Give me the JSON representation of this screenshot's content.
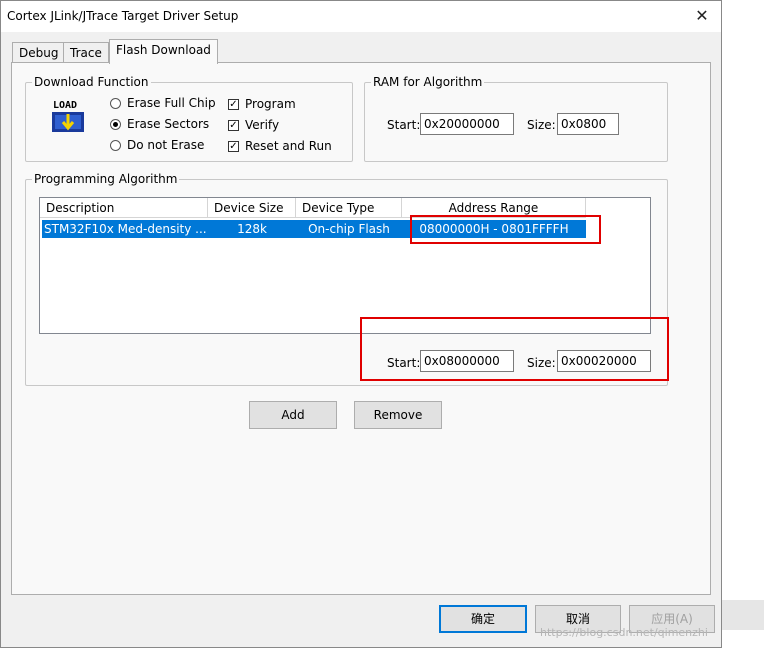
{
  "window": {
    "title": "Cortex JLink/JTrace Target Driver Setup",
    "close_glyph": "✕"
  },
  "tabs": [
    {
      "label": "Debug"
    },
    {
      "label": "Trace"
    },
    {
      "label": "Flash Download",
      "active": true
    }
  ],
  "download_function": {
    "legend": "Download Function",
    "icon_label": "LOAD",
    "radios": [
      {
        "label": "Erase Full Chip",
        "checked": false
      },
      {
        "label": "Erase Sectors",
        "checked": true
      },
      {
        "label": "Do not Erase",
        "checked": false
      }
    ],
    "checkboxes": [
      {
        "label": "Program",
        "checked": true
      },
      {
        "label": "Verify",
        "checked": true
      },
      {
        "label": "Reset and Run",
        "checked": true
      }
    ]
  },
  "ram_for_algorithm": {
    "legend": "RAM for Algorithm",
    "start_label": "Start:",
    "start_value": "0x20000000",
    "size_label": "Size:",
    "size_value": "0x0800"
  },
  "programming_algorithm": {
    "legend": "Programming Algorithm",
    "columns": [
      "Description",
      "Device Size",
      "Device Type",
      "Address Range"
    ],
    "rows": [
      {
        "description": "STM32F10x Med-density ...",
        "device_size": "128k",
        "device_type": "On-chip Flash",
        "address_range": "08000000H - 0801FFFFH",
        "selected": true
      }
    ],
    "start_label": "Start:",
    "start_value": "0x08000000",
    "size_label": "Size:",
    "size_value": "0x00020000"
  },
  "buttons": {
    "add": "Add",
    "remove": "Remove",
    "ok": "确定",
    "cancel": "取消",
    "apply": "应用(A)"
  },
  "watermark": "https://blog.csdn.net/qimenzhi",
  "colors": {
    "selection": "#0078d7",
    "annotation": "#e00000"
  }
}
